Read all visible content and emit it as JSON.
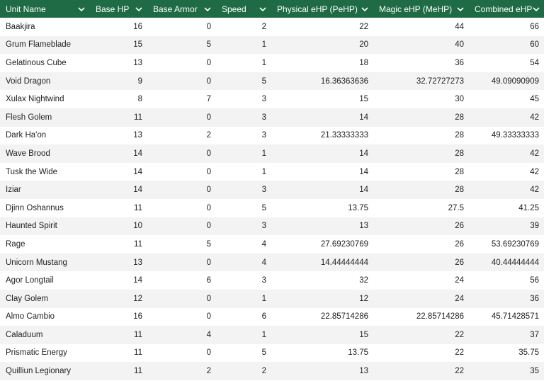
{
  "header": {
    "columns": [
      {
        "label": "Unit Name",
        "icon": "chevron-down-icon"
      },
      {
        "label": "Base HP",
        "icon": "chevron-down-icon"
      },
      {
        "label": "Base Armor",
        "icon": "chevron-down-icon"
      },
      {
        "label": "Speed",
        "icon": "chevron-down-icon"
      },
      {
        "label": "Physical eHP (PeHP)",
        "icon": "chevron-down-icon"
      },
      {
        "label": "Magic eHP (MeHP)",
        "icon": "chevron-down-icon"
      },
      {
        "label": "Combined eHP",
        "icon": "chevron-down-icon"
      }
    ]
  },
  "colors": {
    "header_bg": "#1e6b45",
    "row_stripe": "#f3f3f3"
  },
  "rows": [
    [
      "Baakjira",
      "16",
      "0",
      "2",
      "22",
      "44",
      "66"
    ],
    [
      "Grum Flameblade",
      "15",
      "5",
      "1",
      "20",
      "40",
      "60"
    ],
    [
      "Gelatinous Cube",
      "13",
      "0",
      "1",
      "18",
      "36",
      "54"
    ],
    [
      "Void Dragon",
      "9",
      "0",
      "5",
      "16.36363636",
      "32.72727273",
      "49.09090909"
    ],
    [
      "Xulax Nightwind",
      "8",
      "7",
      "3",
      "15",
      "30",
      "45"
    ],
    [
      "Flesh Golem",
      "11",
      "0",
      "3",
      "14",
      "28",
      "42"
    ],
    [
      "Dark Ha'on",
      "13",
      "2",
      "3",
      "21.33333333",
      "28",
      "49.33333333"
    ],
    [
      "Wave Brood",
      "14",
      "0",
      "1",
      "14",
      "28",
      "42"
    ],
    [
      "Tusk the Wide",
      "14",
      "0",
      "1",
      "14",
      "28",
      "42"
    ],
    [
      "Iziar",
      "14",
      "0",
      "3",
      "14",
      "28",
      "42"
    ],
    [
      "Djinn Oshannus",
      "11",
      "0",
      "5",
      "13.75",
      "27.5",
      "41.25"
    ],
    [
      "Haunted Spirit",
      "10",
      "0",
      "3",
      "13",
      "26",
      "39"
    ],
    [
      "Rage",
      "11",
      "5",
      "4",
      "27.69230769",
      "26",
      "53.69230769"
    ],
    [
      "Unicorn Mustang",
      "13",
      "0",
      "4",
      "14.44444444",
      "26",
      "40.44444444"
    ],
    [
      "Agor Longtail",
      "14",
      "6",
      "3",
      "32",
      "24",
      "56"
    ],
    [
      "Clay Golem",
      "12",
      "0",
      "1",
      "12",
      "24",
      "36"
    ],
    [
      "Almo Cambio",
      "16",
      "0",
      "6",
      "22.85714286",
      "22.85714286",
      "45.71428571"
    ],
    [
      "Caladuum",
      "11",
      "4",
      "1",
      "15",
      "22",
      "37"
    ],
    [
      "Prismatic Energy",
      "11",
      "0",
      "5",
      "13.75",
      "22",
      "35.75"
    ],
    [
      "Quilliun Legionary",
      "11",
      "2",
      "2",
      "13",
      "22",
      "35"
    ]
  ]
}
